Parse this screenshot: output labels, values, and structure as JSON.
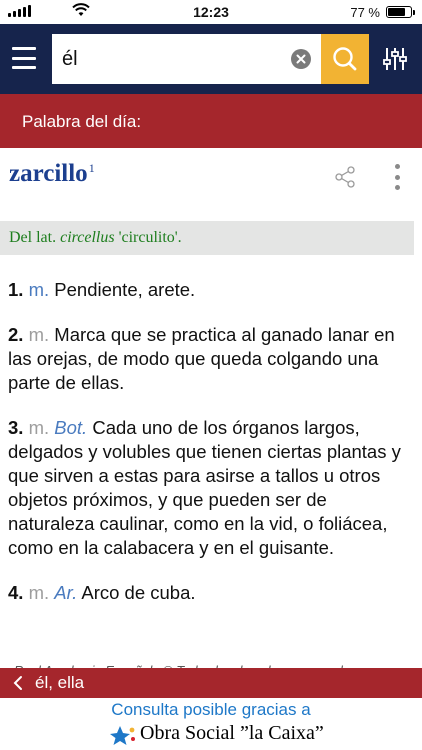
{
  "status_bar": {
    "time": "12:23",
    "battery_percent": "77 %",
    "battery_level": 0.77
  },
  "search": {
    "value": "él",
    "placeholder": ""
  },
  "word_of_day": {
    "label": "Palabra del día:"
  },
  "entry": {
    "headword": "zarcillo",
    "superscript": "1",
    "etymology": {
      "prefix": "Del lat. ",
      "latin": "circellus",
      "gloss": " 'circulito'."
    },
    "definitions": [
      {
        "number": "1.",
        "category": "m.",
        "abbr": "",
        "text": " Pendiente, arete."
      },
      {
        "number": "2.",
        "category": "m.",
        "abbr": "",
        "text": " Marca que se practica al ganado lanar en las orejas, de modo que queda colgando una parte de ellas."
      },
      {
        "number": "3.",
        "category": "m.",
        "abbr": "Bot.",
        "text": " Cada uno de los órganos largos, delgados y volubles que tienen ciertas plantas y que sirven a estas para asirse a tallos u otros objetos próximos, y que pueden ser de naturaleza caulinar, como en la vid, o foliácea, como en la calabacera y en el guisante."
      },
      {
        "number": "4.",
        "category": "m.",
        "abbr": "Ar.",
        "text": " Arco de cuba."
      }
    ],
    "copyright": "Real Academia Española © Todos los derechos reservados"
  },
  "back_nav": {
    "label": "él, ella"
  },
  "sponsor": {
    "line1": "Consulta posible gracias a",
    "brand": "Obra Social ”la Caixa”"
  },
  "colors": {
    "header_navy": "#16244c",
    "accent_red": "#a5262c",
    "search_yellow": "#f2b333",
    "headword_blue": "#1c3f8f",
    "etymology_green": "#1e7e1e"
  },
  "icons": {
    "menu": "hamburger-menu-icon",
    "clear": "clear-icon",
    "search": "search-icon",
    "filter": "sliders-icon",
    "share": "share-icon",
    "more": "more-vertical-icon",
    "back": "chevron-left-icon"
  }
}
